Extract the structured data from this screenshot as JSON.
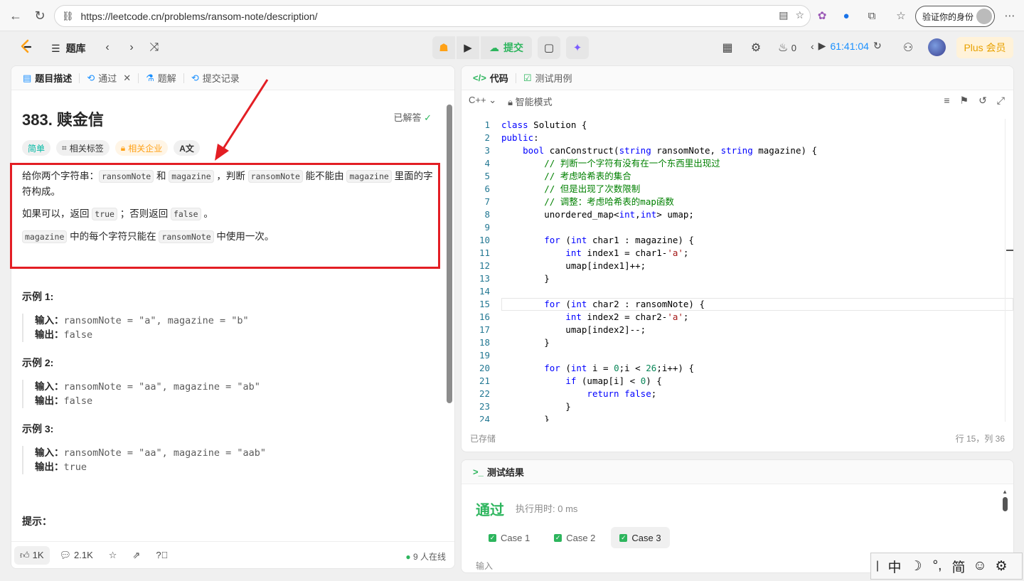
{
  "browser": {
    "url": "https://leetcode.cn/problems/ransom-note/description/",
    "verify_label": "验证你的身份"
  },
  "appbar": {
    "tiku_label": "题库",
    "submit_label": "提交",
    "streak_count": "0",
    "timer": "61:41:04",
    "plus_label": "Plus 会员"
  },
  "tabs": {
    "desc": "题目描述",
    "pass": "通过",
    "solution": "题解",
    "submissions": "提交记录"
  },
  "problem": {
    "title": "383. 赎金信",
    "solved_label": "已解答",
    "tag_easy": "简单",
    "tag_related": "相关标签",
    "tag_company": "相关企业",
    "p1_a": "给你两个字符串：",
    "p1_code1": "ransomNote",
    "p1_b": " 和 ",
    "p1_code2": "magazine",
    "p1_c": " ，判断 ",
    "p1_code3": "ransomNote",
    "p1_d": " 能不能由 ",
    "p1_code4": "magazine",
    "p1_e": " 里面的字符构成。",
    "p2_a": "如果可以，返回 ",
    "p2_code1": "true",
    "p2_b": " ；否则返回 ",
    "p2_code2": "false",
    "p2_c": " 。",
    "p3_code1": "magazine",
    "p3_a": " 中的每个字符只能在 ",
    "p3_code2": "ransomNote",
    "p3_b": " 中使用一次。",
    "examples": [
      {
        "title": "示例 1:",
        "input_label": "输入：",
        "input": "ransomNote = \"a\", magazine = \"b\"",
        "output_label": "输出：",
        "output": "false"
      },
      {
        "title": "示例 2:",
        "input_label": "输入：",
        "input": "ransomNote = \"aa\", magazine = \"ab\"",
        "output_label": "输出：",
        "output": "false"
      },
      {
        "title": "示例 3:",
        "input_label": "输入：",
        "input": "ransomNote = \"aa\", magazine = \"aab\"",
        "output_label": "输出：",
        "output": "true"
      }
    ],
    "hint_title": "提示："
  },
  "footer": {
    "likes": "1K",
    "comments": "2.1K",
    "online": "9 人在线"
  },
  "code_panel": {
    "tab_code": "代码",
    "tab_testcase": "测试用例",
    "language": "C++",
    "mode": "智能模式",
    "status": "已存储",
    "position": "行 15，列 36",
    "current_line": 15,
    "lines": [
      "class Solution {",
      "public:",
      "    bool canConstruct(string ransomNote, string magazine) {",
      "        // 判断一个字符有没有在一个东西里出现过",
      "        // 考虑哈希表的集合",
      "        // 但是出现了次数限制",
      "        // 调整：考虑哈希表的map函数",
      "        unordered_map<int,int> umap;",
      "",
      "        for (int char1 : magazine) {",
      "            int index1 = char1-'a';",
      "            umap[index1]++;",
      "        }",
      "",
      "        for (int char2 : ransomNote) {",
      "            int index2 = char2-'a';",
      "            umap[index2]--;",
      "        }",
      "",
      "        for (int i = 0;i < 26;i++) {",
      "            if (umap[i] < 0) {",
      "                return false;",
      "            }",
      "        }"
    ]
  },
  "result_panel": {
    "title": "测试结果",
    "status": "通过",
    "runtime": "执行用时: 0 ms",
    "cases": [
      "Case 1",
      "Case 2",
      "Case 3"
    ],
    "active_case": 3,
    "input_label": "输入"
  },
  "ime": [
    "中",
    "☽",
    "°,",
    "简",
    "☺",
    "⚙"
  ],
  "colors": {
    "accent_green": "#2db55d",
    "annotation_red": "#e31e24",
    "timer_blue": "#1a90ff"
  }
}
